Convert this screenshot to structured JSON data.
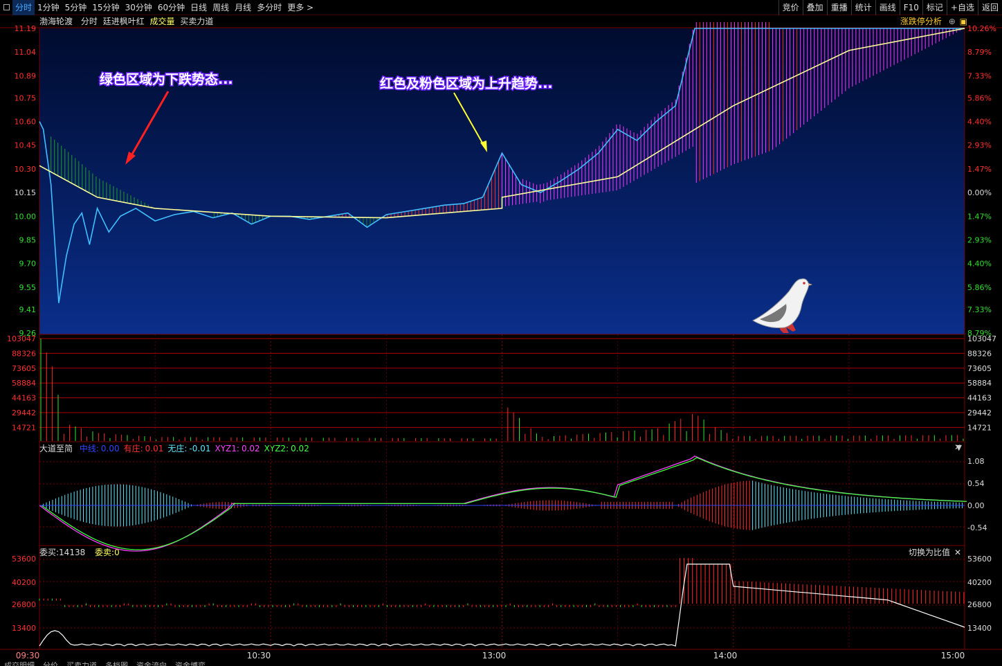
{
  "toolbar": {
    "periods": [
      "分时",
      "1分钟",
      "5分钟",
      "15分钟",
      "30分钟",
      "60分钟",
      "日线",
      "周线",
      "月线",
      "多分时",
      "更多 >"
    ],
    "active_period": "分时",
    "tools": [
      "竞价",
      "叠加",
      "重播",
      "统计",
      "画线",
      "F10",
      "标记",
      "+自选",
      "返回"
    ]
  },
  "price_panel": {
    "stock_name": "渤海轮渡",
    "view": "分时",
    "indicator": "廷进枫叶红",
    "volume_label": "成交量",
    "buy_sell_label": "买卖力道",
    "right_link": "涨跌停分析",
    "annotation_left": "绿色区域为下跌势态...",
    "annotation_right": "红色及粉色区域为上升趋势...",
    "price_ticks": [
      "11.19",
      "11.04",
      "10.89",
      "10.75",
      "10.60",
      "10.45",
      "10.30",
      "10.15",
      "10.00",
      "9.85",
      "9.70",
      "9.55",
      "9.41",
      "9.26"
    ],
    "pct_ticks": [
      "10.26%",
      "8.79%",
      "7.33%",
      "5.86%",
      "4.40%",
      "2.93%",
      "1.47%",
      "0.00%",
      "1.47%",
      "2.93%",
      "4.40%",
      "5.86%",
      "7.33%",
      "8.79%"
    ]
  },
  "volume_panel": {
    "ticks": [
      "103047",
      "88326",
      "73605",
      "58884",
      "44163",
      "29442",
      "14721"
    ]
  },
  "dadao_panel": {
    "title": "大道至简",
    "items": [
      {
        "label": "中线:",
        "value": "0.00",
        "color": "#2e45ff"
      },
      {
        "label": "有庄:",
        "value": "0.01",
        "color": "#ff3030"
      },
      {
        "label": "无庄:",
        "value": "-0.01",
        "color": "#5fe8ff"
      },
      {
        "label": "XYZ1:",
        "value": "0.02",
        "color": "#ff40ff"
      },
      {
        "label": "XYZ2:",
        "value": "0.02",
        "color": "#40ff40"
      }
    ],
    "ticks": [
      "1.08",
      "0.54",
      "0.00",
      "-0.54"
    ]
  },
  "order_panel": {
    "buy_label": "委买:14138",
    "sell_label": "委卖:0",
    "switch_label": "切换为比值",
    "ticks": [
      "53600",
      "40200",
      "26800",
      "13400"
    ]
  },
  "time_axis": [
    "09:30",
    "10:30",
    "13:00",
    "14:00",
    "15:00"
  ],
  "bottom_tabs": [
    "成交明细",
    "分价",
    "买卖力道",
    "多档图",
    "资金流向",
    "资金博弈"
  ],
  "colors": {
    "up": "#ff2a2a",
    "down": "#2ee82e",
    "price_line": "#40c0ff",
    "avg_line": "#ffff99",
    "pink_fill": "#ff33ff",
    "panel_bg_top": "#000b2e",
    "panel_bg_bottom": "#0a2e8a"
  },
  "chart_data": {
    "type": "line",
    "title": "渤海轮渡 分时",
    "prev_close": 10.15,
    "limit_up": 11.19,
    "y_range": [
      9.26,
      11.19
    ],
    "price_series": {
      "time": [
        "09:30",
        "09:31",
        "09:33",
        "09:35",
        "09:37",
        "09:39",
        "09:41",
        "09:43",
        "09:45",
        "09:48",
        "09:51",
        "09:55",
        "10:00",
        "10:05",
        "10:10",
        "10:15",
        "10:20",
        "10:25",
        "10:30",
        "10:35",
        "10:40",
        "10:45",
        "10:50",
        "10:55",
        "11:00",
        "11:05",
        "11:10",
        "11:15",
        "11:20",
        "11:25",
        "11:30",
        "13:05",
        "13:10",
        "13:15",
        "13:20",
        "13:25",
        "13:30",
        "13:35",
        "13:40",
        "13:45",
        "13:50",
        "13:55",
        "14:00",
        "14:05",
        "14:10",
        "14:20",
        "14:30",
        "14:40",
        "14:50",
        "15:00"
      ],
      "values": [
        10.6,
        10.55,
        10.2,
        9.45,
        9.75,
        9.95,
        10.02,
        9.82,
        10.05,
        9.9,
        10.0,
        10.05,
        9.97,
        10.01,
        10.03,
        9.99,
        10.02,
        9.95,
        10.0,
        10.0,
        9.98,
        10.0,
        10.02,
        9.93,
        10.01,
        10.03,
        10.05,
        10.07,
        10.08,
        10.12,
        10.4,
        10.2,
        10.15,
        10.22,
        10.3,
        10.4,
        10.55,
        10.48,
        10.6,
        10.7,
        11.19,
        11.19,
        11.19,
        11.19,
        11.19,
        11.19,
        11.19,
        11.19,
        11.19,
        11.19
      ]
    },
    "avg_series": {
      "time": [
        "09:30",
        "09:45",
        "10:00",
        "10:30",
        "11:00",
        "11:30",
        "13:00",
        "13:30",
        "14:00",
        "14:30",
        "15:00"
      ],
      "values": [
        10.32,
        10.12,
        10.05,
        10.0,
        9.99,
        10.05,
        10.12,
        10.25,
        10.7,
        11.05,
        11.19
      ]
    },
    "volume": {
      "time": [
        "09:30",
        "09:33",
        "09:36",
        "09:45",
        "10:00",
        "11:30",
        "13:00",
        "13:10",
        "13:40",
        "13:50",
        "13:55",
        "14:00",
        "15:00"
      ],
      "values": [
        103047,
        75000,
        18000,
        8000,
        4000,
        2500,
        39000,
        4000,
        12000,
        28000,
        15000,
        5000,
        6000
      ]
    }
  }
}
